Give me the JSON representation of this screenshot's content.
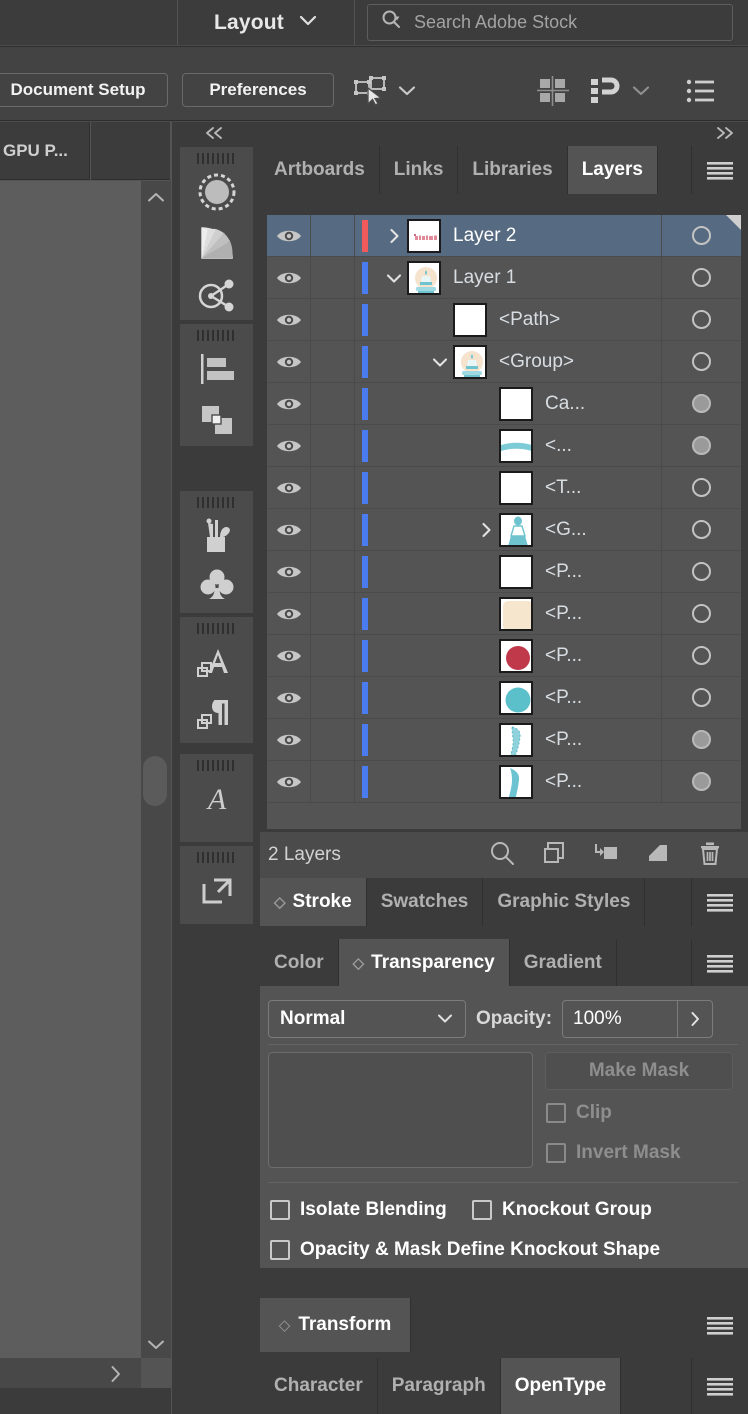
{
  "appbar": {
    "workspace_label": "Layout",
    "workspace_chevron": "chevron-down",
    "search_placeholder": "Search Adobe Stock",
    "search_value": ""
  },
  "controlbar": {
    "document_setup_label": "Document Setup",
    "preferences_label": "Preferences",
    "select_similar_icon": "select-similar-objects-icon",
    "select_similar_chevron": "chevron-down",
    "align_icon": "align-grid-icon",
    "distribute_icon": "distribute-spacing-icon",
    "distribute_chevron": "chevron-down",
    "list_icon": "document-list-icon"
  },
  "left_panel": {
    "gpu_tab_label": "GPU P...",
    "scroll_up_icon": "chevron-up",
    "scroll_down_icon": "chevron-down",
    "scroll_right_icon": "chevron-right"
  },
  "tool_rail": {
    "collapse_icon": "double-chevron-left",
    "groups": [
      {
        "tools": [
          "appearance-circle-icon",
          "gradient-wedge-icon",
          "graphic-styles-icon"
        ]
      },
      {
        "tools": [
          "align-left-icon",
          "pathfinder-shapes-icon"
        ]
      },
      {
        "tools": [
          "brushes-icon",
          "symbols-clover-icon"
        ]
      },
      {
        "tools": [
          "character-styles-icon",
          "paragraph-styles-icon"
        ]
      },
      {
        "tools": [
          "glyphs-icon"
        ]
      },
      {
        "tools": [
          "export-arrow-icon"
        ]
      }
    ]
  },
  "dock": {
    "collapse_icon": "double-chevron-right",
    "upper_tabs": [
      {
        "label": "Artboards",
        "active": false
      },
      {
        "label": "Links",
        "active": false
      },
      {
        "label": "Libraries",
        "active": false
      },
      {
        "label": "Layers",
        "active": true
      }
    ],
    "upper_menu_icon": "panel-menu-icon"
  },
  "layers_panel": {
    "rows": [
      {
        "name": "Layer 2",
        "indent": 0,
        "twisty": "chevron-right",
        "selected": true,
        "target": "ring",
        "swatch": "#f05a5a",
        "thumb": "thumb-text-pink",
        "eye": true
      },
      {
        "name": "Layer 1",
        "indent": 0,
        "twisty": "chevron-down",
        "selected": false,
        "target": "ring",
        "swatch": "#4a7cf0",
        "thumb": "thumb-snowglobe",
        "eye": true
      },
      {
        "name": "<Path>",
        "indent": 1,
        "twisty": "",
        "selected": false,
        "target": "ring",
        "swatch": "#4a7cf0",
        "thumb": "thumb-white",
        "eye": true
      },
      {
        "name": "<Group>",
        "indent": 1,
        "twisty": "chevron-down",
        "selected": false,
        "target": "ring",
        "swatch": "#4a7cf0",
        "thumb": "thumb-snowglobe",
        "eye": true
      },
      {
        "name": "Ca...",
        "indent": 2,
        "twisty": "",
        "selected": false,
        "target": "filled",
        "swatch": "#4a7cf0",
        "thumb": "thumb-white",
        "eye": true
      },
      {
        "name": "<...",
        "indent": 2,
        "twisty": "",
        "selected": false,
        "target": "filled",
        "swatch": "#4a7cf0",
        "thumb": "thumb-teal-band",
        "eye": true
      },
      {
        "name": "<T...",
        "indent": 2,
        "twisty": "",
        "selected": false,
        "target": "ring",
        "swatch": "#4a7cf0",
        "thumb": "thumb-white",
        "eye": true
      },
      {
        "name": "<G...",
        "indent": 2,
        "twisty": "chevron-right",
        "selected": false,
        "target": "ring",
        "swatch": "#4a7cf0",
        "thumb": "thumb-figure",
        "eye": true
      },
      {
        "name": "<P...",
        "indent": 2,
        "twisty": "",
        "selected": false,
        "target": "ring",
        "swatch": "#4a7cf0",
        "thumb": "thumb-white",
        "eye": true
      },
      {
        "name": "<P...",
        "indent": 2,
        "twisty": "",
        "selected": false,
        "target": "ring",
        "swatch": "#4a7cf0",
        "thumb": "thumb-cream",
        "eye": true
      },
      {
        "name": "<P...",
        "indent": 2,
        "twisty": "",
        "selected": false,
        "target": "ring",
        "swatch": "#4a7cf0",
        "thumb": "thumb-red-dot",
        "eye": true
      },
      {
        "name": "<P...",
        "indent": 2,
        "twisty": "",
        "selected": false,
        "target": "ring",
        "swatch": "#4a7cf0",
        "thumb": "thumb-teal-dot",
        "eye": true
      },
      {
        "name": "<P...",
        "indent": 2,
        "twisty": "",
        "selected": false,
        "target": "filled",
        "swatch": "#4a7cf0",
        "thumb": "thumb-teal-blobA",
        "eye": true
      },
      {
        "name": "<P...",
        "indent": 2,
        "twisty": "",
        "selected": false,
        "target": "filled",
        "swatch": "#4a7cf0",
        "thumb": "thumb-teal-blobB",
        "eye": true
      }
    ],
    "footer": {
      "count_label": "2 Layers",
      "icons": [
        "locate-object-icon",
        "make-sublayer-icon",
        "release-to-layers-icon",
        "new-layer-icon",
        "delete-layer-icon"
      ]
    }
  },
  "stroke_group": {
    "tabs": [
      {
        "label": "Stroke",
        "active": true
      },
      {
        "label": "Swatches",
        "active": false
      },
      {
        "label": "Graphic Styles",
        "active": false
      }
    ],
    "menu_icon": "panel-menu-icon"
  },
  "transparency_group": {
    "tabs": [
      {
        "label": "Color",
        "active": false
      },
      {
        "label": "Transparency",
        "active": true
      },
      {
        "label": "Gradient",
        "active": false
      }
    ],
    "menu_icon": "panel-menu-icon",
    "blend_mode": "Normal",
    "blend_chevron": "chevron-down",
    "opacity_label": "Opacity:",
    "opacity_value": "100%",
    "opacity_stepper_icon": "chevron-right",
    "make_mask_label": "Make Mask",
    "clip_label": "Clip",
    "clip_checked": false,
    "invert_mask_label": "Invert Mask",
    "invert_mask_checked": false,
    "isolate_blending_label": "Isolate Blending",
    "isolate_blending_checked": false,
    "knockout_group_label": "Knockout Group",
    "knockout_group_checked": false,
    "opacity_mask_label": "Opacity & Mask Define Knockout Shape",
    "opacity_mask_checked": false
  },
  "transform_group": {
    "tab_label": "Transform",
    "menu_icon": "panel-menu-icon"
  },
  "type_group": {
    "tabs": [
      {
        "label": "Character",
        "active": false
      },
      {
        "label": "Paragraph",
        "active": false
      },
      {
        "label": "OpenType",
        "active": true
      }
    ],
    "menu_icon": "panel-menu-icon"
  },
  "colors": {
    "selection_blue": "#566b82",
    "panel_bg": "#545454",
    "dock_bg": "#3b3b3b",
    "tab_inactive": "#3b3b3b",
    "accent_red": "#f05a5a",
    "accent_blue": "#4a7cf0"
  }
}
